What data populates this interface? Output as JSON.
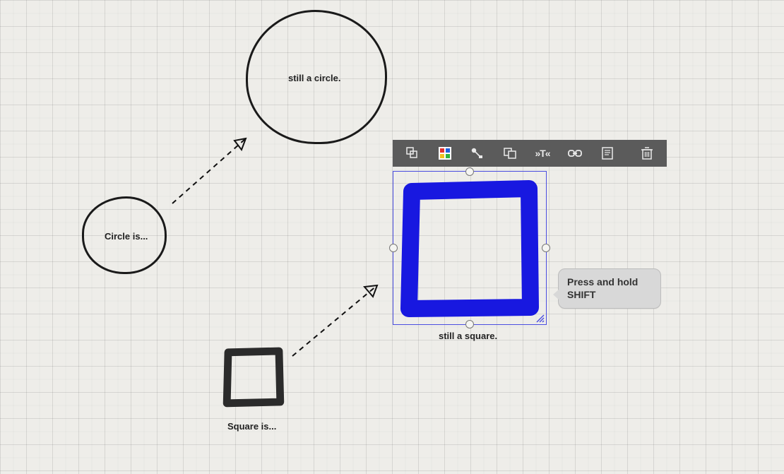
{
  "shapes": {
    "circle_small_label": "Circle is...",
    "circle_big_label": "still a circle.",
    "square_small_label": "Square is...",
    "square_big_label": "still a square."
  },
  "tooltip": {
    "text": "Press and hold SHIFT"
  },
  "toolbar": {
    "shape_label": "Shape",
    "color_label": "Color",
    "connect_label": "Connect",
    "group_label": "Group",
    "text_label": "»T«",
    "link_label": "Link",
    "note_label": "Note",
    "delete_label": "Delete"
  },
  "colors": {
    "accent_blue": "#1818e0",
    "selection_border": "#4a4de0",
    "toolbar_bg": "#5b5b5b",
    "tooltip_bg": "#d8d8d8"
  }
}
